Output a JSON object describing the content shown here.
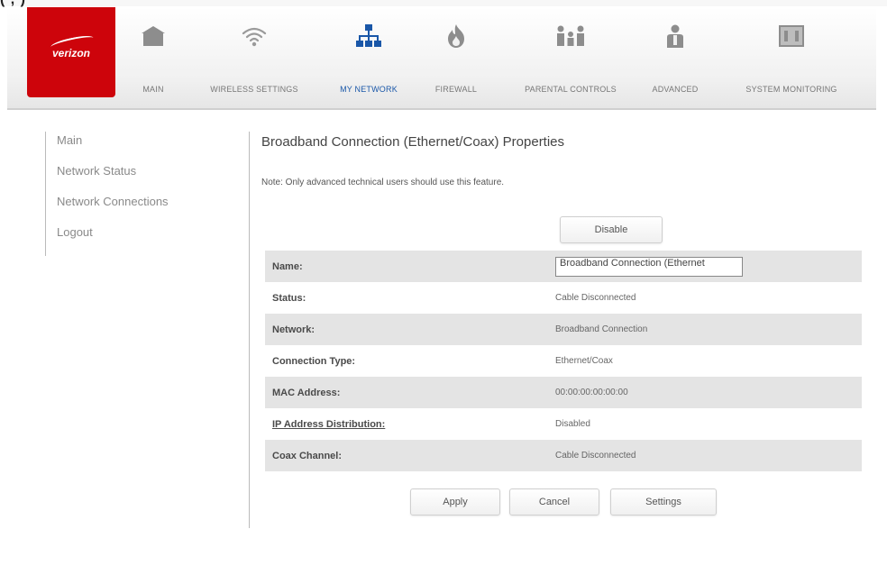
{
  "top_fragment": "( , )",
  "brand": {
    "logo_text": "verizon",
    "accent": "#cd040b",
    "nav_active": "#1a57a8"
  },
  "nav": [
    {
      "label": "MAIN",
      "icon": "home-icon",
      "active": false
    },
    {
      "label": "WIRELESS SETTINGS",
      "icon": "wifi-icon",
      "active": false
    },
    {
      "label": "MY NETWORK",
      "icon": "network-icon",
      "active": true
    },
    {
      "label": "FIREWALL",
      "icon": "flame-icon",
      "active": false
    },
    {
      "label": "PARENTAL CONTROLS",
      "icon": "family-icon",
      "active": false
    },
    {
      "label": "ADVANCED",
      "icon": "advanced-user-icon",
      "active": false
    },
    {
      "label": "SYSTEM MONITORING",
      "icon": "monitor-icon",
      "active": false
    }
  ],
  "sidebar": [
    {
      "label": "Main"
    },
    {
      "label": "Network Status"
    },
    {
      "label": "Network Connections"
    },
    {
      "label": "Logout"
    }
  ],
  "page": {
    "title": "Broadband Connection (Ethernet/Coax) Properties",
    "note": "Note: Only advanced technical users should use this feature.",
    "disable_label": "Disable"
  },
  "properties": [
    {
      "label": "Name:",
      "value": "Broadband Connection (Ethernet",
      "editable": true
    },
    {
      "label": "Status:",
      "value": "Cable Disconnected"
    },
    {
      "label": "Network:",
      "value": "Broadband Connection"
    },
    {
      "label": "Connection Type:",
      "value": "Ethernet/Coax"
    },
    {
      "label": "MAC Address:",
      "value": "00:00:00:00:00:00"
    },
    {
      "label": "IP Address Distribution:",
      "value": "Disabled",
      "link": true
    },
    {
      "label": "Coax Channel:",
      "value": "Cable Disconnected"
    }
  ],
  "actions": {
    "apply": "Apply",
    "cancel": "Cancel",
    "settings": "Settings"
  }
}
